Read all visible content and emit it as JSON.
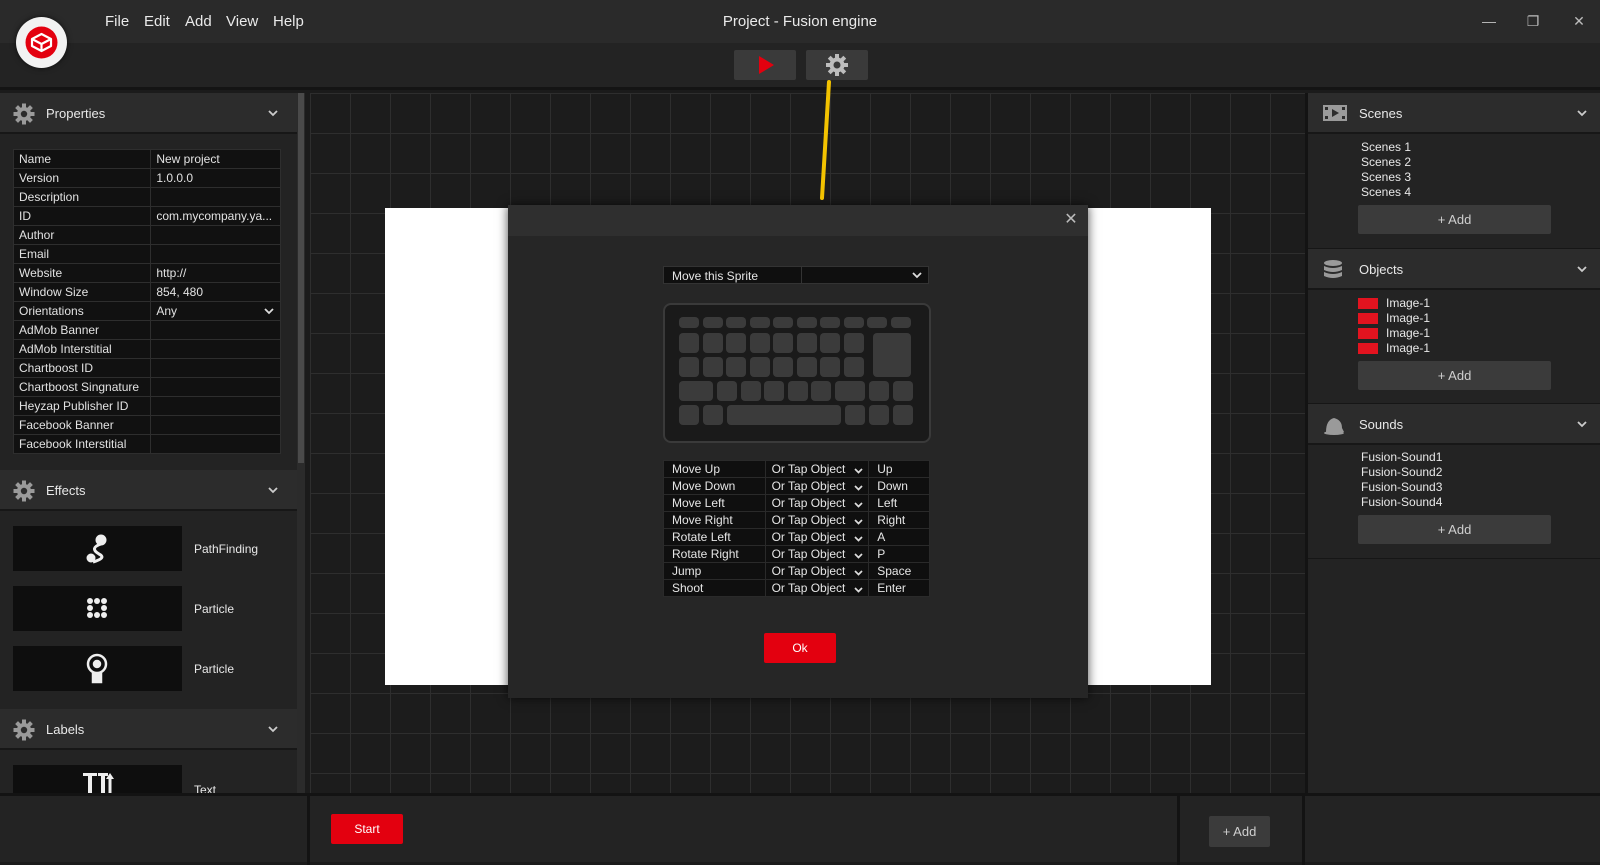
{
  "window": {
    "title": "Project - Fusion engine",
    "menu": [
      "File",
      "Edit",
      "Add",
      "View",
      "Help"
    ],
    "minimize": "—",
    "maximize": "❐",
    "close": "✕"
  },
  "properties": {
    "title": "Properties",
    "rows": [
      {
        "key": "Name",
        "value": "New project"
      },
      {
        "key": "Version",
        "value": "1.0.0.0"
      },
      {
        "key": "Description",
        "value": ""
      },
      {
        "key": "ID",
        "value": "com.mycompany.ya..."
      },
      {
        "key": "Author",
        "value": ""
      },
      {
        "key": "Email",
        "value": ""
      },
      {
        "key": "Website",
        "value": "http://"
      },
      {
        "key": "Window Size",
        "value": "854, 480"
      },
      {
        "key": "Orientations",
        "value": "Any"
      },
      {
        "key": "AdMob Banner",
        "value": ""
      },
      {
        "key": "AdMob Interstitial",
        "value": ""
      },
      {
        "key": "Chartboost ID",
        "value": ""
      },
      {
        "key": "Chartboost Singnature",
        "value": ""
      },
      {
        "key": "Heyzap Publisher ID",
        "value": ""
      },
      {
        "key": "Facebook Banner",
        "value": ""
      },
      {
        "key": "Facebook Interstitial",
        "value": ""
      }
    ]
  },
  "effects": {
    "title": "Effects",
    "items": [
      "PathFinding",
      "Particle",
      "Particle"
    ]
  },
  "labels": {
    "title": "Labels",
    "items": [
      "Text"
    ]
  },
  "dialog": {
    "sprite_select": "Move this Sprite",
    "ok_label": "Ok",
    "bindings": [
      {
        "action": "Move Up",
        "option": "Or Tap Object",
        "key": "Up"
      },
      {
        "action": "Move Down",
        "option": "Or Tap Object",
        "key": "Down"
      },
      {
        "action": "Move Left",
        "option": "Or Tap Object",
        "key": "Left"
      },
      {
        "action": "Move Right",
        "option": "Or Tap Object",
        "key": "Right"
      },
      {
        "action": "Rotate Left",
        "option": "Or Tap Object",
        "key": "A"
      },
      {
        "action": "Rotate Right",
        "option": "Or Tap Object",
        "key": "P"
      },
      {
        "action": "Jump",
        "option": "Or Tap Object",
        "key": "Space"
      },
      {
        "action": "Shoot",
        "option": "Or Tap Object",
        "key": "Enter"
      }
    ]
  },
  "scenes": {
    "title": "Scenes",
    "items": [
      "Scenes 1",
      "Scenes 2",
      "Scenes 3",
      "Scenes 4"
    ],
    "add_label": "+ Add"
  },
  "objects": {
    "title": "Objects",
    "items": [
      "Image-1",
      "Image-1",
      "Image-1",
      "Image-1"
    ],
    "swatch_color": "#e3131f",
    "add_label": "+ Add"
  },
  "sounds": {
    "title": "Sounds",
    "items": [
      "Fusion-Sound1",
      "Fusion-Sound2",
      "Fusion-Sound3",
      "Fusion-Sound4"
    ],
    "add_label": "+ Add"
  },
  "bottom": {
    "start_label": "Start",
    "add_label": "+ Add"
  },
  "colors": {
    "accent": "#e3000f",
    "highlight_line": "#f2c200"
  }
}
